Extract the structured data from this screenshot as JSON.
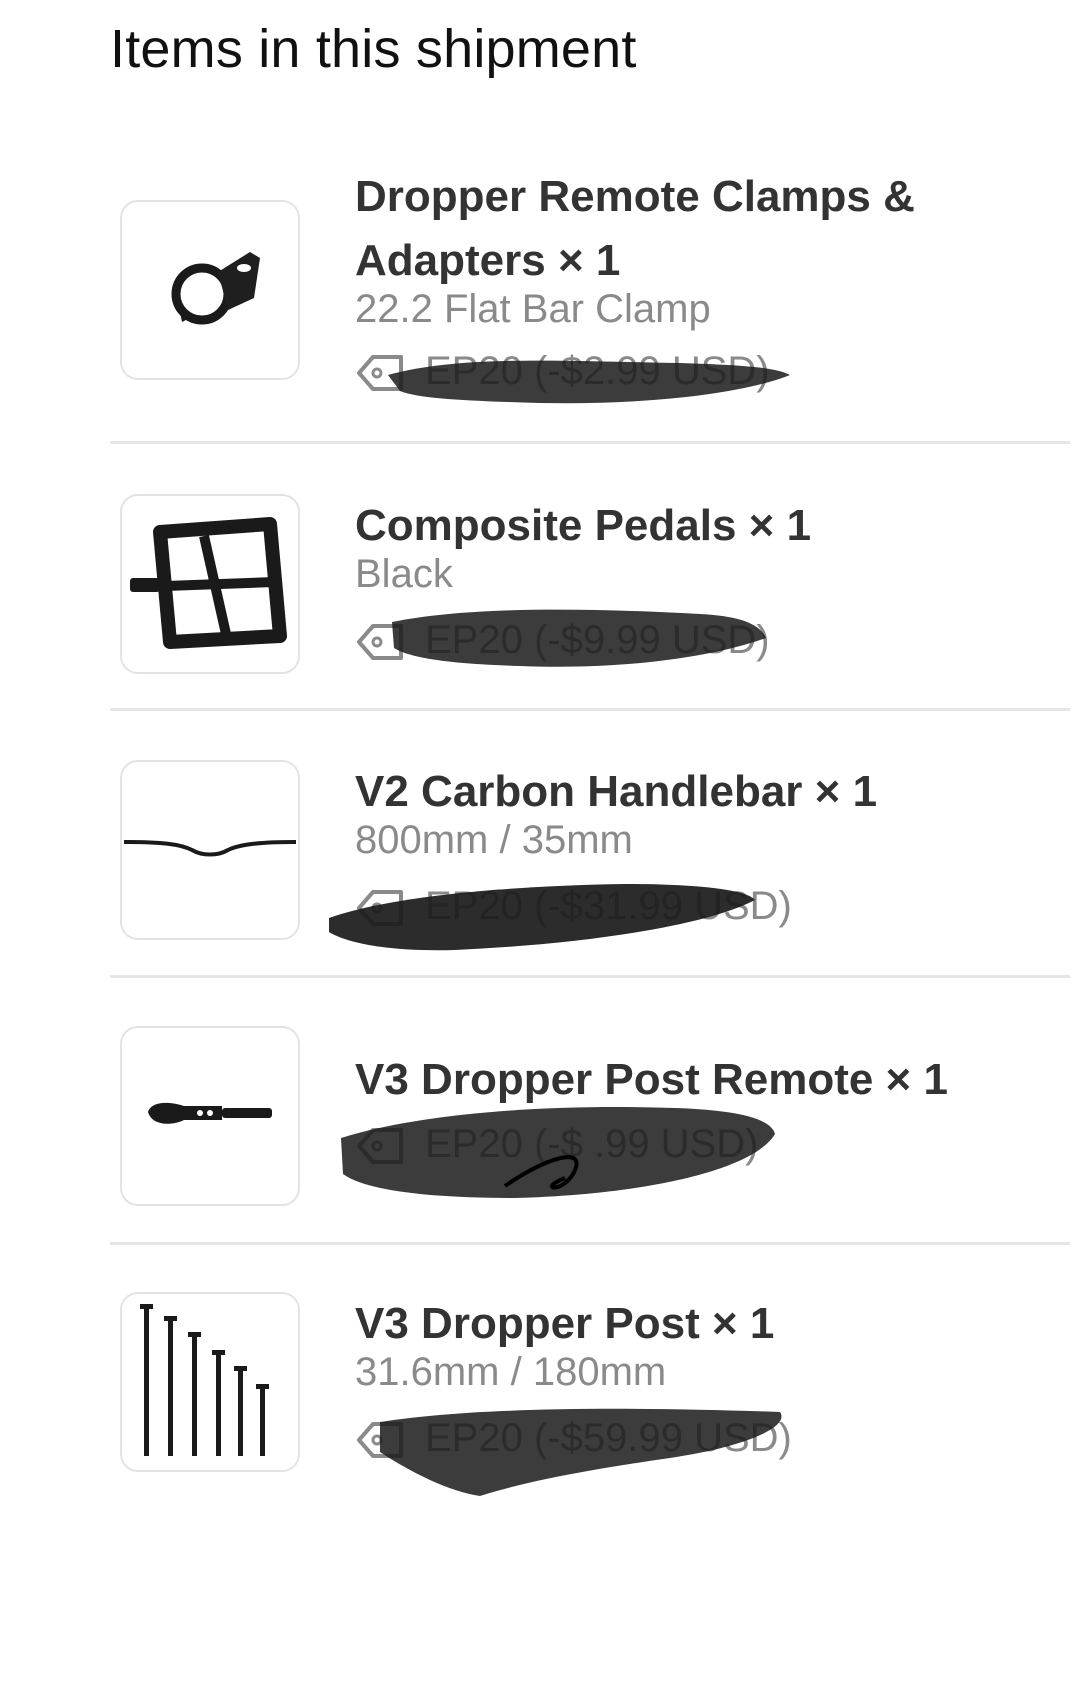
{
  "page": {
    "title": "Items in this shipment"
  },
  "items": [
    {
      "name": "Dropper Remote Clamps & Adapters × 1",
      "variant": "22.2 Flat Bar Clamp",
      "discount": "EP20 (-$2.99 USD)",
      "image_icon": "clamp-icon"
    },
    {
      "name": "Composite Pedals × 1",
      "variant": "Black",
      "discount": "EP20 (-$9.99 USD)",
      "image_icon": "pedal-icon"
    },
    {
      "name": "V2 Carbon Handlebar × 1",
      "variant": "800mm / 35mm",
      "discount": "EP20 (-$31.99 USD)",
      "image_icon": "handlebar-icon"
    },
    {
      "name": "V3 Dropper Post Remote × 1",
      "variant": "",
      "discount": "EP20 (-$ .99 USD)",
      "image_icon": "remote-lever-icon"
    },
    {
      "name": "V3 Dropper Post × 1",
      "variant": "31.6mm / 180mm",
      "discount": "EP20 (-$59.99 USD)",
      "image_icon": "dropper-post-icon"
    }
  ],
  "colors": {
    "name": "#333333",
    "secondary": "#8a8a8a",
    "divider": "#e6e6e6",
    "redaction": "#1a1a1a"
  }
}
